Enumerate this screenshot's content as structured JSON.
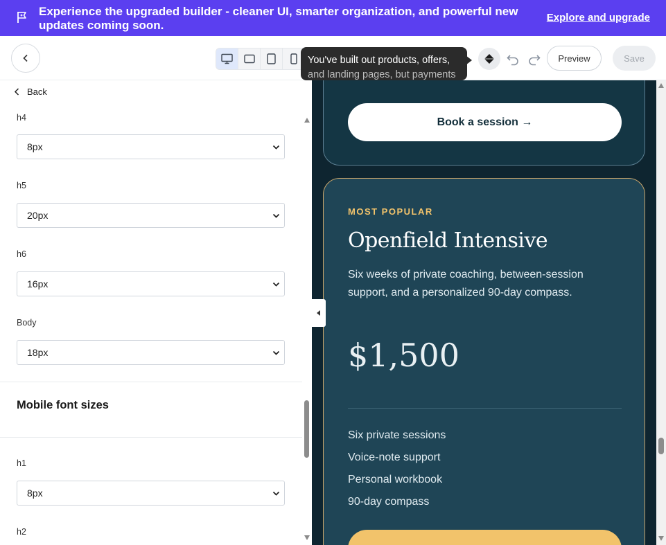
{
  "banner": {
    "message": "Experience the upgraded builder - cleaner UI, smarter organization, and powerful new updates coming soon.",
    "link": "Explore and upgrade",
    "color": "#5b3ff0"
  },
  "toolbar": {
    "devices": [
      {
        "name": "desktop-icon",
        "active": true
      },
      {
        "name": "tablet-landscape-icon",
        "active": false
      },
      {
        "name": "tablet-portrait-icon",
        "active": false
      },
      {
        "name": "mobile-icon",
        "active": false
      }
    ],
    "tooltip_line1": "You've built out products, offers,",
    "tooltip_line2": "and landing pages, but payments",
    "preview_label": "Preview",
    "save_label": "Save"
  },
  "panel": {
    "back_label": "Back",
    "fields_top": [
      {
        "label": "h4",
        "value": "8px"
      },
      {
        "label": "h5",
        "value": "20px"
      },
      {
        "label": "h6",
        "value": "16px"
      },
      {
        "label": "Body",
        "value": "18px"
      }
    ],
    "section_title": "Mobile font sizes",
    "fields_mobile": [
      {
        "label": "h1",
        "value": "8px"
      },
      {
        "label": "h2",
        "value": ""
      }
    ]
  },
  "canvas": {
    "book_button": "Book a session →",
    "plan": {
      "badge": "MOST POPULAR",
      "title": "Openfield Intensive",
      "description": "Six weeks of private coaching, between-session support, and a personalized 90-day compass.",
      "price": "$1,500",
      "features": [
        "Six private sessions",
        "Voice-note support",
        "Personal workbook",
        "90-day compass"
      ]
    },
    "colors": {
      "background": "#0e2530",
      "card": "#1f4556",
      "accent": "#f2c36b"
    }
  }
}
